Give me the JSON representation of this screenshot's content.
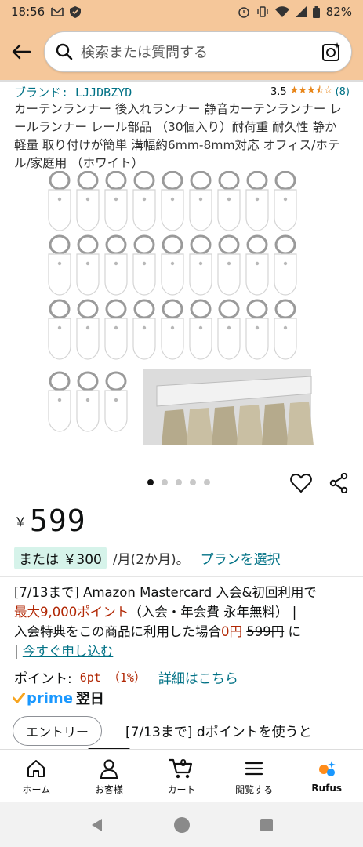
{
  "status_bar": {
    "time": "18:56",
    "battery": "82%"
  },
  "search": {
    "placeholder": "検索または質問する"
  },
  "product": {
    "brand": "ブランド: LJJDBZYD",
    "rating_value": "3.5",
    "rating_stars": 3.5,
    "rating_count": "(8)",
    "title": "カーテンランナー 後入れランナー 静音カーテンランナー レールランナー レール部品 （30個入り）耐荷重 耐久性 静か 軽量 取り付けが簡単 溝幅約6mm-8mm対応 オフィス/ホテル/家庭用 （ホワイト）"
  },
  "gallery": {
    "image_count": 5,
    "active_index": 0
  },
  "price": {
    "symbol": "￥",
    "value": "599"
  },
  "installment": {
    "badge": "または ￥300",
    "text": "/月(2か月)。",
    "plan_link": "プランを選択"
  },
  "promo": {
    "line1": "[7/13まで] Amazon Mastercard 入会&初回利用で",
    "highlight": "最大9,000ポイント",
    "line2_rest": "（入会・年会費 永年無料） |",
    "line3_start": "入会特典をこの商品に利用した場合",
    "zero_price": "0円",
    "strike_price": "599円",
    "line3_end": " に",
    "bar": "|",
    "apply_link": "今すぐ申し込む"
  },
  "points": {
    "label": "ポイント:",
    "value": "6pt （1%）",
    "link": "詳細はこちら"
  },
  "prime": {
    "label": "prime",
    "delivery": "翌日"
  },
  "entry": {
    "button_label": "エントリー",
    "text": "[7/13まで] dポイントを使うと"
  },
  "bottom_nav": {
    "items": [
      {
        "label": "ホーム",
        "icon": "home-icon"
      },
      {
        "label": "お客様",
        "icon": "person-icon"
      },
      {
        "label": "カート",
        "icon": "cart-icon",
        "badge": "0"
      },
      {
        "label": "閲覧する",
        "icon": "menu-icon"
      },
      {
        "label": "Rufus",
        "icon": "rufus-icon"
      }
    ],
    "active_index": 1
  },
  "colors": {
    "header_bg": "#f5c79a",
    "link": "#007185",
    "price_red": "#b12704",
    "star": "#e8861a",
    "prime_blue": "#1a98ff",
    "installment_badge": "#d6f3ea"
  }
}
